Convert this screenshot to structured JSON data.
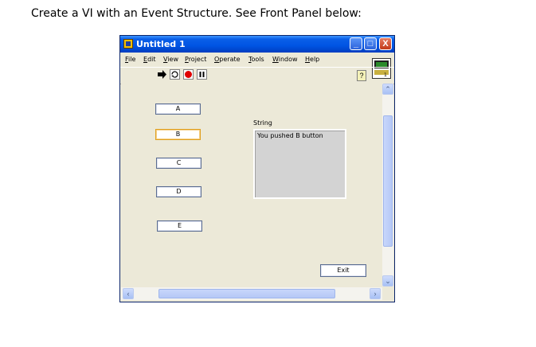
{
  "instruction": "Create a VI with an Event Structure. See Front Panel below:",
  "window": {
    "title": "Untitled 1",
    "controls": {
      "minimize": "_",
      "maximize": "□",
      "close": "X"
    }
  },
  "menu": [
    {
      "label": "File",
      "underline": "F"
    },
    {
      "label": "Edit",
      "underline": "E"
    },
    {
      "label": "View",
      "underline": "V"
    },
    {
      "label": "Project",
      "underline": "P"
    },
    {
      "label": "Operate",
      "underline": "O"
    },
    {
      "label": "Tools",
      "underline": "T"
    },
    {
      "label": "Window",
      "underline": "W"
    },
    {
      "label": "Help",
      "underline": "H"
    }
  ],
  "toolbar": {
    "run": "run-arrow-icon",
    "run_continuous": "run-continuous-icon",
    "abort": "abort-icon",
    "pause": "pause-icon",
    "help": "?"
  },
  "buttons": [
    "A",
    "B",
    "C",
    "D",
    "E"
  ],
  "focused_button": "B",
  "string_indicator": {
    "label": "String",
    "value": "You pushed B button"
  },
  "exit_button": "Exit",
  "colors": {
    "titlebar": "#0054e3",
    "panel": "#ece9d8",
    "string_bg": "#d3d3d3",
    "abort_red": "#e00000"
  }
}
